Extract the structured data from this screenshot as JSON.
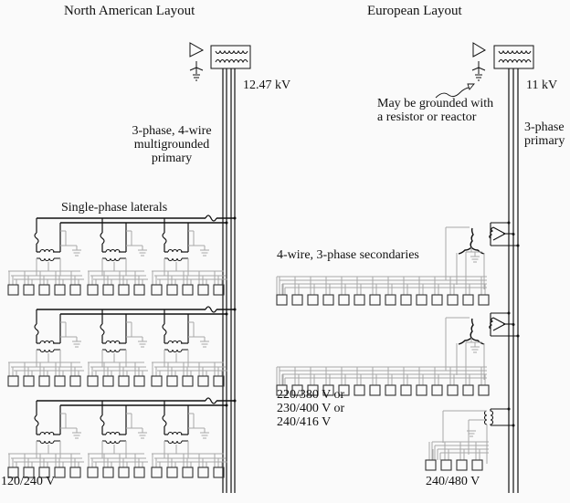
{
  "colors": {
    "background": "#fafafa",
    "primary_wire": "#111111",
    "secondary_wire": "#a8a8a8",
    "meter": "#333333"
  },
  "north_american": {
    "title": "North American Layout",
    "source_voltage": "12.47 kV",
    "primary_label": [
      "3-phase, 4-wire",
      "multigrounded",
      "primary"
    ],
    "laterals_label": "Single-phase laterals",
    "secondary_voltage": "120/240 V",
    "lateral_groups": 3,
    "transformers_per_lateral": 3,
    "meters_per_transformer": [
      5,
      4,
      5
    ],
    "icons": [
      "substation-transformer-icon",
      "arrester-icon",
      "ground-icon",
      "single-phase-transformer-icon",
      "fuse-icon",
      "meter-icon"
    ]
  },
  "european": {
    "title": "European Layout",
    "source_voltage": "11 kV",
    "primary_label": [
      "3-phase",
      "primary"
    ],
    "grounding_note": [
      "May be grounded with",
      "a resistor or reactor"
    ],
    "secondaries_label": "4-wire, 3-phase secondaries",
    "secondary_voltage_options": [
      "220/380 V or",
      "230/400 V or",
      "240/416 V"
    ],
    "single_phase_voltage": "240/480 V",
    "three_phase_secondaries": 2,
    "meters_per_three_phase_secondary": 14,
    "single_phase_meters": 4,
    "icons": [
      "substation-transformer-icon",
      "arrester-icon",
      "ground-icon",
      "delta-wye-transformer-icon",
      "single-phase-transformer-icon",
      "meter-icon"
    ]
  }
}
